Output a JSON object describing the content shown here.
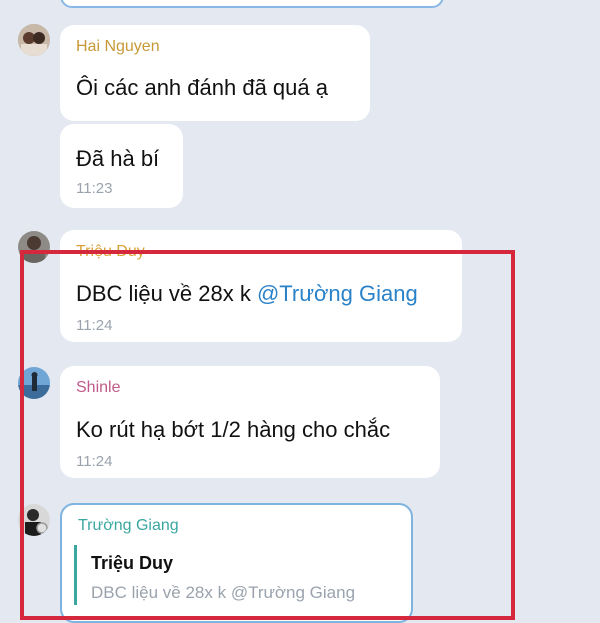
{
  "messages": [
    {
      "sender": "Hai Nguyen",
      "sender_color": "#c79a37",
      "text": "Ôi các anh đánh đã quá ạ"
    },
    {
      "text": "Đã hà bí",
      "time": "11:23"
    },
    {
      "sender": "Triệu Duy",
      "sender_color": "#d9a236",
      "text_plain": "DBC liệu về 28x k ",
      "mention": "@Trường Giang",
      "time": "11:24"
    },
    {
      "sender": "Shinle",
      "sender_color": "#c05a8a",
      "text": "Ko rút hạ bớt 1/2 hàng cho chắc",
      "time": "11:24"
    },
    {
      "sender": "Trường Giang",
      "sender_color": "#3aa7a0",
      "quote_sender": "Triệu Duy",
      "quote_text": "DBC liệu về 28x k @Trường Giang"
    }
  ],
  "colors": {
    "background": "#e3e8f1",
    "highlight": "#d6283d",
    "mention": "#2a82c9"
  }
}
